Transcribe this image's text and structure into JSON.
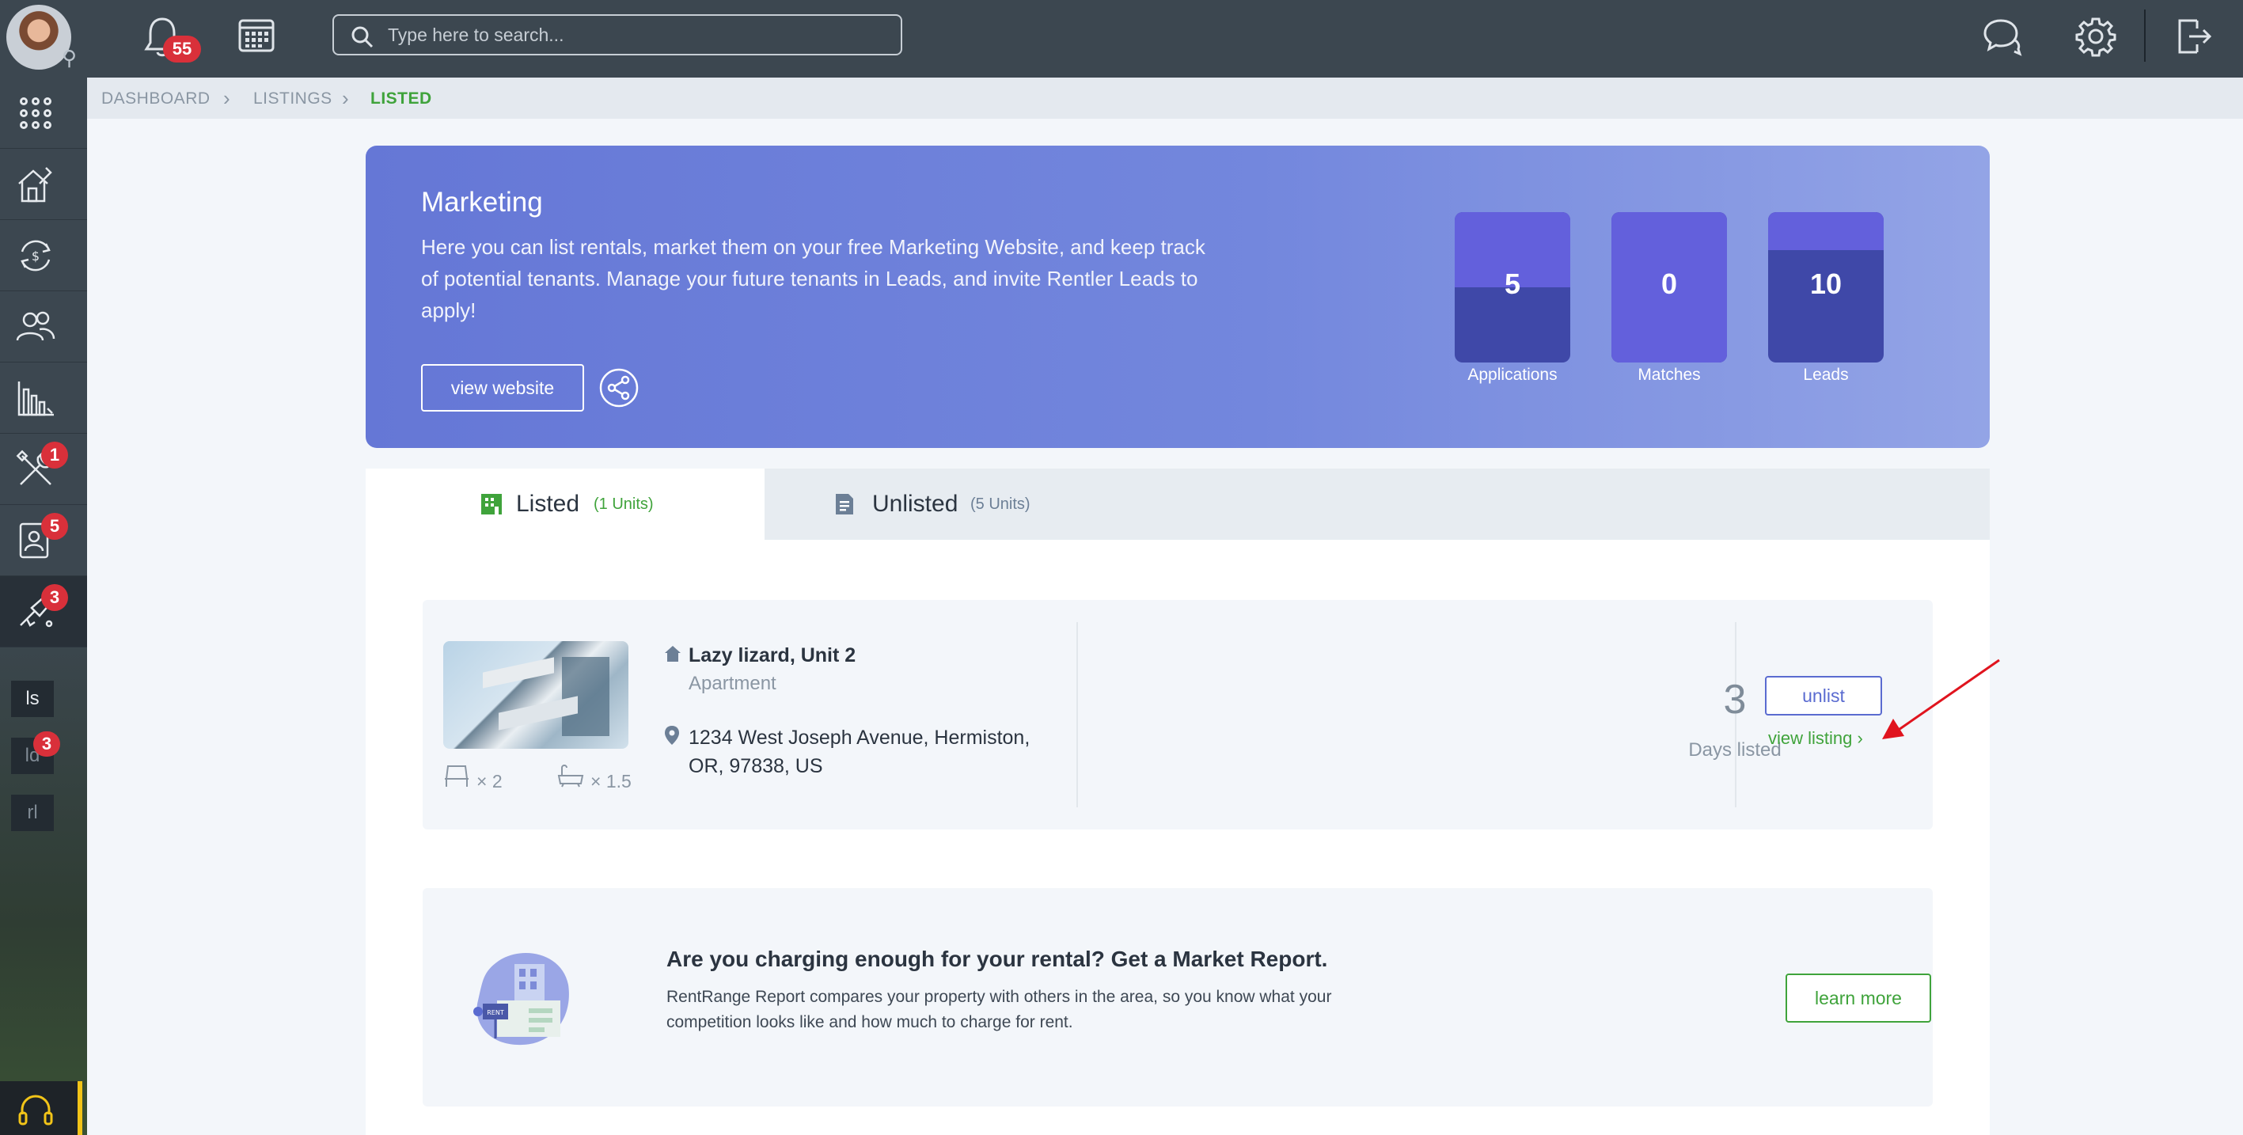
{
  "header": {
    "notification_count": "55",
    "search": {
      "placeholder": "Type here to search..."
    }
  },
  "sidebar": {
    "items": [
      {
        "icon": "apps-grid-icon"
      },
      {
        "icon": "properties-house-icon"
      },
      {
        "icon": "payments-cycle-icon"
      },
      {
        "icon": "people-icon"
      },
      {
        "icon": "reports-chart-icon"
      },
      {
        "icon": "maintenance-tools-icon",
        "badge": "1"
      },
      {
        "icon": "tenants-contact-icon",
        "badge": "5"
      },
      {
        "icon": "marketing-megaphone-icon",
        "badge": "3"
      }
    ],
    "mini_items": [
      {
        "label": "ls"
      },
      {
        "label": "ld",
        "badge": "3"
      },
      {
        "label": "rl"
      }
    ]
  },
  "breadcrumb": {
    "items": [
      "DASHBOARD",
      "LISTINGS",
      "LISTED"
    ]
  },
  "marketing": {
    "title": "Marketing",
    "description": "Here you can list rentals, market them on your free Marketing Website, and keep track of potential tenants. Manage your future tenants in Leads, and invite Rentler Leads to apply!",
    "view_website_label": "view website",
    "stats": [
      {
        "value": "5",
        "label": "Applications",
        "fill_fraction": 0.5
      },
      {
        "value": "0",
        "label": "Matches",
        "fill_fraction": 1.0
      },
      {
        "value": "10",
        "label": "Leads",
        "fill_fraction": 0.25
      }
    ]
  },
  "tabs": [
    {
      "label": "Listed",
      "count": "(1 Units)",
      "active": true
    },
    {
      "label": "Unlisted",
      "count": "(5 Units)",
      "active": false
    }
  ],
  "listing": {
    "name": "Lazy lizard, Unit 2",
    "type": "Apartment",
    "address": "1234 West Joseph Avenue, Hermiston, OR, 97838, US",
    "beds": "× 2",
    "baths": "× 1.5",
    "days_listed": "3",
    "days_label": "Days listed",
    "unlist_label": "unlist",
    "view_label": "view listing ›"
  },
  "market_report": {
    "title": "Are you charging enough for your rental? Get a Market Report.",
    "description": "RentRange Report compares your property with others in the area, so you know what your competition looks like and how much to charge for rent.",
    "button_label": "learn more",
    "illustration_text": "RENT"
  },
  "colors": {
    "topbar": "#3c4750",
    "accent_green": "#3fa33b",
    "accent_blue": "#5a6bd0",
    "badge_red": "#d9303a",
    "annotation_arrow": "#e0141e"
  }
}
